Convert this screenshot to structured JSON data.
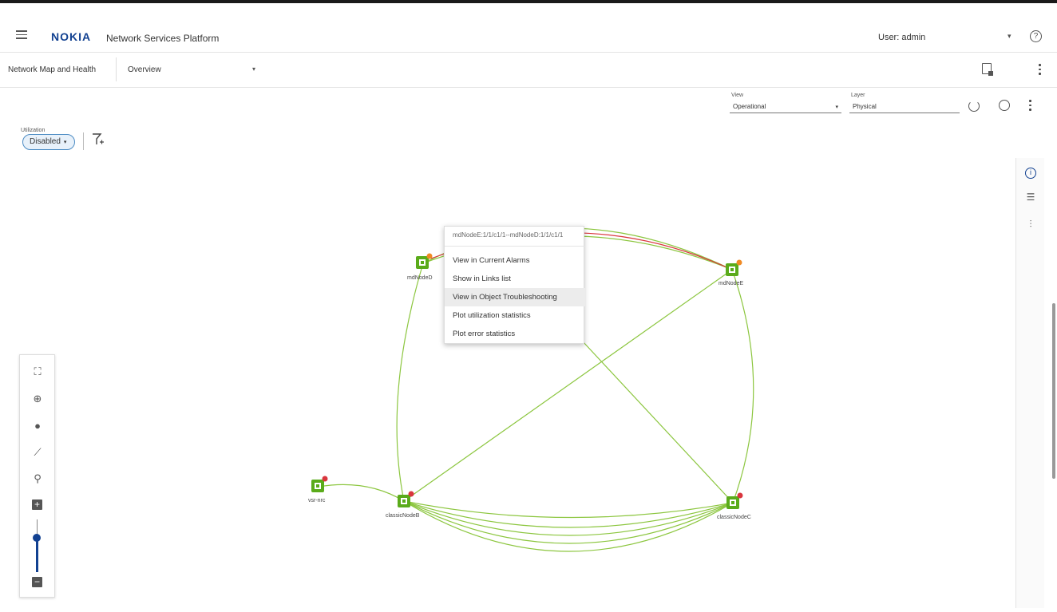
{
  "header": {
    "logo": "NOKIA",
    "app_title": "Network Services Platform",
    "user_label": "User: admin",
    "user_caret": "▾",
    "help_glyph": "?"
  },
  "subbar": {
    "section": "Network Map and Health",
    "view_selected": "Overview",
    "view_caret": "▾"
  },
  "toolbar": {
    "view_label": "View",
    "view_value": "Operational",
    "layer_label": "Layer",
    "layer_value": "Physical",
    "utilization_label": "Utilization",
    "utilization_value": "Disabled",
    "caret": "▾"
  },
  "context_menu": {
    "title": "mdNodeE:1/1/c1/1--mdNodeD:1/1/c1/1",
    "items": [
      "View in Current Alarms",
      "Show in Links list",
      "View in Object Troubleshooting",
      "Plot utilization statistics",
      "Plot error statistics"
    ],
    "highlighted_index": 2
  },
  "nodes": [
    {
      "name": "mdNodeD",
      "status": "orange"
    },
    {
      "name": "mdNodeE",
      "status": "orange"
    },
    {
      "name": "vsr-nrc",
      "status": "red"
    },
    {
      "name": "classicNodeB",
      "status": "red"
    },
    {
      "name": "classicNodeC",
      "status": "red"
    }
  ],
  "colors": {
    "brand": "#124191",
    "link_ok": "#8cc63f",
    "link_alarm": "#d9363e",
    "node_green": "#5aab1a",
    "badge_orange": "#f08a24",
    "badge_red": "#d9363e"
  },
  "icons": {
    "menu": "hamburger-icon",
    "help": "help-icon",
    "report": "report-icon",
    "refresh": "refresh-icon",
    "locate": "target-icon",
    "filter": "filter-add-icon",
    "info": "info-icon",
    "list": "list-icon",
    "settings": "sliders-icon"
  }
}
